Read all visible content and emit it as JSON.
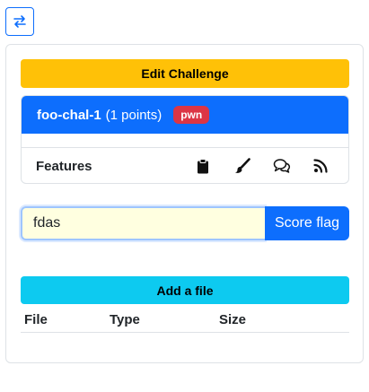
{
  "toolbar": {
    "swap_icon": "swap-arrows-icon"
  },
  "edit_button": {
    "label": "Edit Challenge",
    "color": "#ffc107"
  },
  "challenge": {
    "name": "foo-chal-1",
    "points": "(1 points)",
    "tag": "pwn",
    "header_color": "#0d6efd",
    "tag_color": "#dc3545"
  },
  "features": {
    "label": "Features",
    "icons": [
      "clipboard-icon",
      "paintbrush-icon",
      "chat-bubbles-icon",
      "rss-icon"
    ]
  },
  "flag_form": {
    "value": "fdas",
    "submit_label": "Score flag"
  },
  "files": {
    "add_label": "Add a file",
    "add_color": "#0dcaf0",
    "columns": [
      "File",
      "Type",
      "Size"
    ],
    "rows": []
  }
}
